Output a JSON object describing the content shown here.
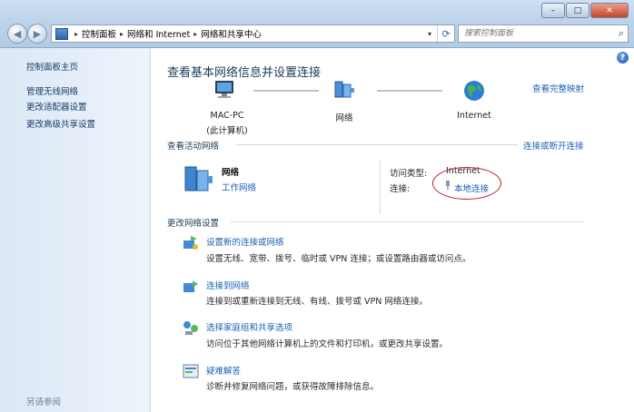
{
  "window": {
    "controls": {
      "minimize": "–",
      "maximize": "□",
      "close": "✕"
    }
  },
  "nav": {
    "back_glyph": "◀",
    "forward_glyph": "▶",
    "breadcrumb": [
      "控制面板",
      "网络和 Internet",
      "网络和共享中心"
    ],
    "separator": "▸",
    "dropdown_glyph": "▾",
    "refresh_glyph": "⟳",
    "search_placeholder": "搜索控制面板",
    "search_icon": "search-icon"
  },
  "sidebar": {
    "items": [
      {
        "label": "控制面板主页"
      },
      {
        "label": "管理无线网络"
      },
      {
        "label": "更改适配器设置"
      },
      {
        "label": "更改高级共享设置"
      }
    ],
    "see_also": "另请参阅"
  },
  "main": {
    "help_glyph": "?",
    "title": "查看基本网络信息并设置连接",
    "view_full_map": "查看完整映射",
    "map": {
      "computer_name": "MAC-PC",
      "computer_sub": "(此计算机)",
      "network": "网络",
      "internet": "Internet"
    },
    "active_networks": {
      "heading": "查看活动网络",
      "connect_disconnect": "连接或断开连接",
      "network_name": "网络",
      "network_type": "工作网络",
      "access_type_label": "访问类型:",
      "access_type_value": "Internet",
      "connections_label": "连接:",
      "connections_value": "本地连接"
    },
    "change_settings": {
      "heading": "更改网络设置",
      "tasks": [
        {
          "title": "设置新的连接或网络",
          "desc": "设置无线、宽带、拨号、临时或 VPN 连接；或设置路由器或访问点。"
        },
        {
          "title": "连接到网络",
          "desc": "连接到或重新连接到无线、有线、拨号或 VPN 网络连接。"
        },
        {
          "title": "选择家庭组和共享选项",
          "desc": "访问位于其他网络计算机上的文件和打印机，或更改共享设置。"
        },
        {
          "title": "疑难解答",
          "desc": "诊断并修复网络问题，或获得故障排除信息。"
        }
      ]
    }
  },
  "colors": {
    "link": "#1b5fb6",
    "highlight_circle": "#c0202a"
  }
}
